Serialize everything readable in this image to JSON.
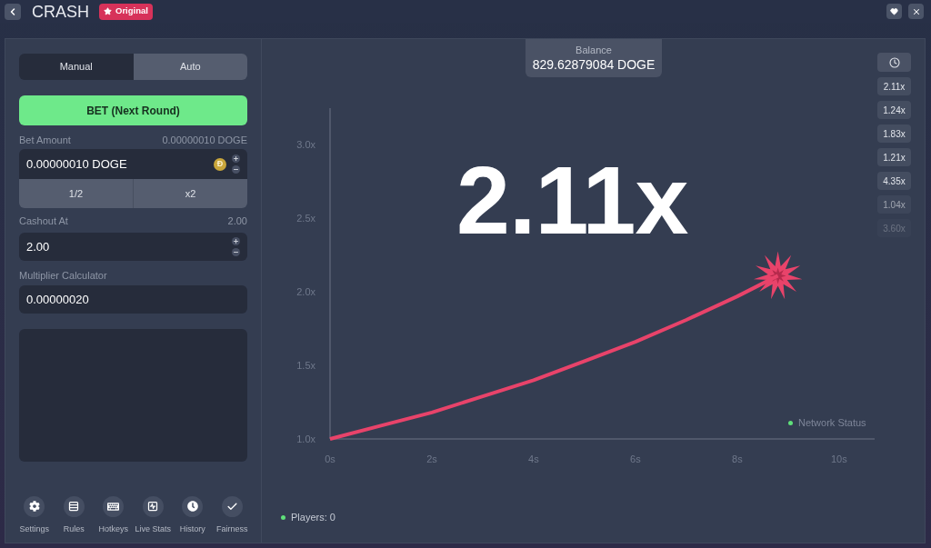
{
  "header": {
    "title": "CRASH",
    "badge": "Original"
  },
  "bet_panel": {
    "mode_tabs": [
      {
        "label": "Manual",
        "selected": true
      },
      {
        "label": "Auto",
        "selected": false
      }
    ],
    "bet_button": "BET (Next Round)",
    "bet_amount": {
      "label": "Bet Amount",
      "reading": "0.00000010 DOGE",
      "value": "0.00000010 DOGE",
      "coin_symbol": "Đ",
      "buttons": [
        "1/2",
        "x2"
      ]
    },
    "cashout": {
      "label": "Cashout At",
      "reading": "2.00",
      "value": "2.00"
    },
    "multiplier_calculator": {
      "label": "Multiplier Calculator",
      "value": "0.00000020"
    },
    "toolbar": [
      {
        "label": "Settings",
        "kind": "gear"
      },
      {
        "label": "Rules",
        "kind": "list"
      },
      {
        "label": "Hotkeys",
        "kind": "keyboard"
      },
      {
        "label": "Live Stats",
        "kind": "stats"
      },
      {
        "label": "History",
        "kind": "clock"
      },
      {
        "label": "Fairness",
        "kind": "check"
      }
    ]
  },
  "balance": {
    "label": "Balance",
    "value": "829.62879084 DOGE"
  },
  "chart": {
    "multiplier": "2.11x",
    "network_status": "Network Status",
    "chart_data": {
      "type": "line",
      "x": [
        0,
        1,
        2,
        3,
        4,
        5,
        6,
        7,
        8,
        8.8
      ],
      "series": [
        {
          "color": "#e8436a",
          "values": [
            1,
            1.09,
            1.18,
            1.29,
            1.4,
            1.53,
            1.66,
            1.81,
            1.97,
            2.11
          ]
        }
      ],
      "xlim": [
        0,
        10.7
      ],
      "ylim": [
        1,
        3.25
      ],
      "xticks": [
        {
          "value": 0,
          "label": "0s"
        },
        {
          "value": 2,
          "label": "2s"
        },
        {
          "value": 4,
          "label": "4s"
        },
        {
          "value": 6,
          "label": "6s"
        },
        {
          "value": 8,
          "label": "8s"
        },
        {
          "value": 10,
          "label": "10s"
        }
      ],
      "yticks": [
        {
          "value": 1,
          "label": "1.0x"
        },
        {
          "value": 1.5,
          "label": "1.5x"
        },
        {
          "value": 2,
          "label": "2.0x"
        },
        {
          "value": 2.5,
          "label": "2.5x"
        },
        {
          "value": 3,
          "label": "3.0x"
        }
      ]
    }
  },
  "history": [
    "2.11x",
    "1.24x",
    "1.83x",
    "1.21x",
    "4.35x",
    "1.04x",
    "3.60x"
  ],
  "players": "Players: 0"
}
